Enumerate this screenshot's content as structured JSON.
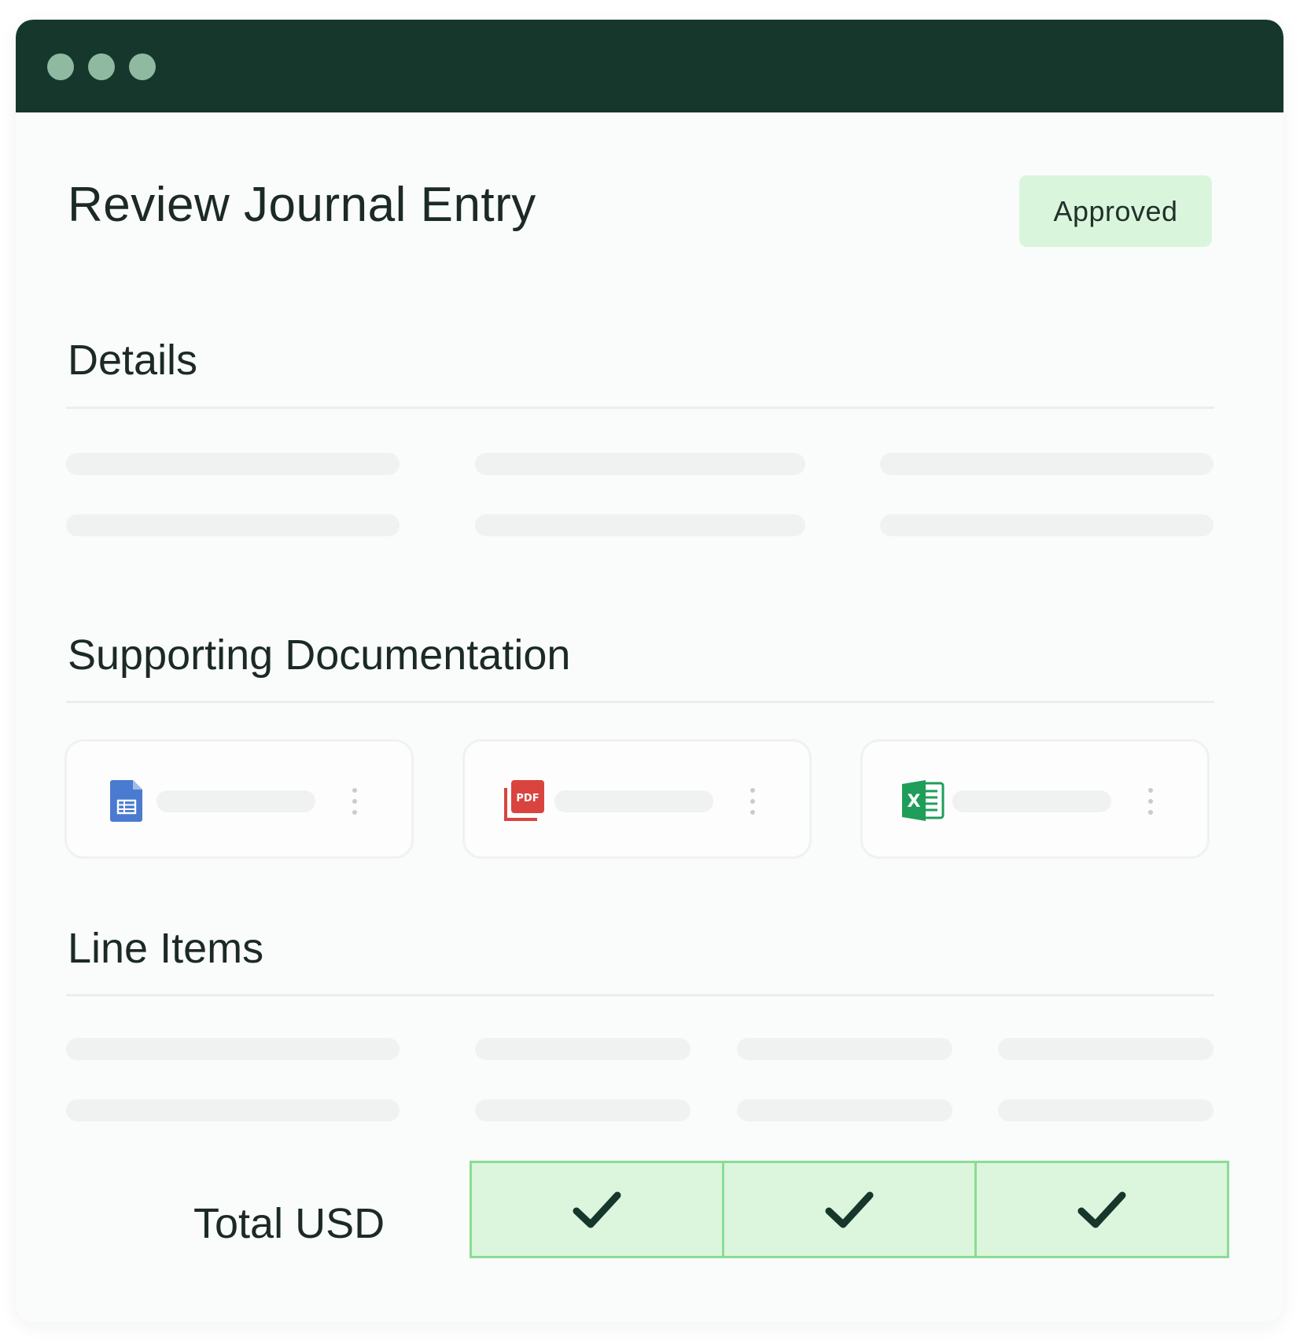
{
  "window": {
    "title_dots": [
      "close",
      "minimize",
      "maximize"
    ]
  },
  "header": {
    "title": "Review Journal Entry",
    "status": "Approved"
  },
  "sections": {
    "details": "Details",
    "documentation": "Supporting Documentation",
    "line_items": "Line Items"
  },
  "documents": [
    {
      "icon": "google-sheets-icon",
      "color": "#4a7bd0"
    },
    {
      "icon": "pdf-icon",
      "color": "#d9443f",
      "icon_text": "PDF"
    },
    {
      "icon": "excel-icon",
      "color": "#1f9d5a",
      "icon_text": "X"
    }
  ],
  "totals": {
    "label": "Total USD",
    "checks": [
      true,
      true,
      true
    ]
  },
  "colors": {
    "titlebar": "#16372c",
    "accent_green": "#8bdc92",
    "approved_bg": "#d9f6dc"
  }
}
